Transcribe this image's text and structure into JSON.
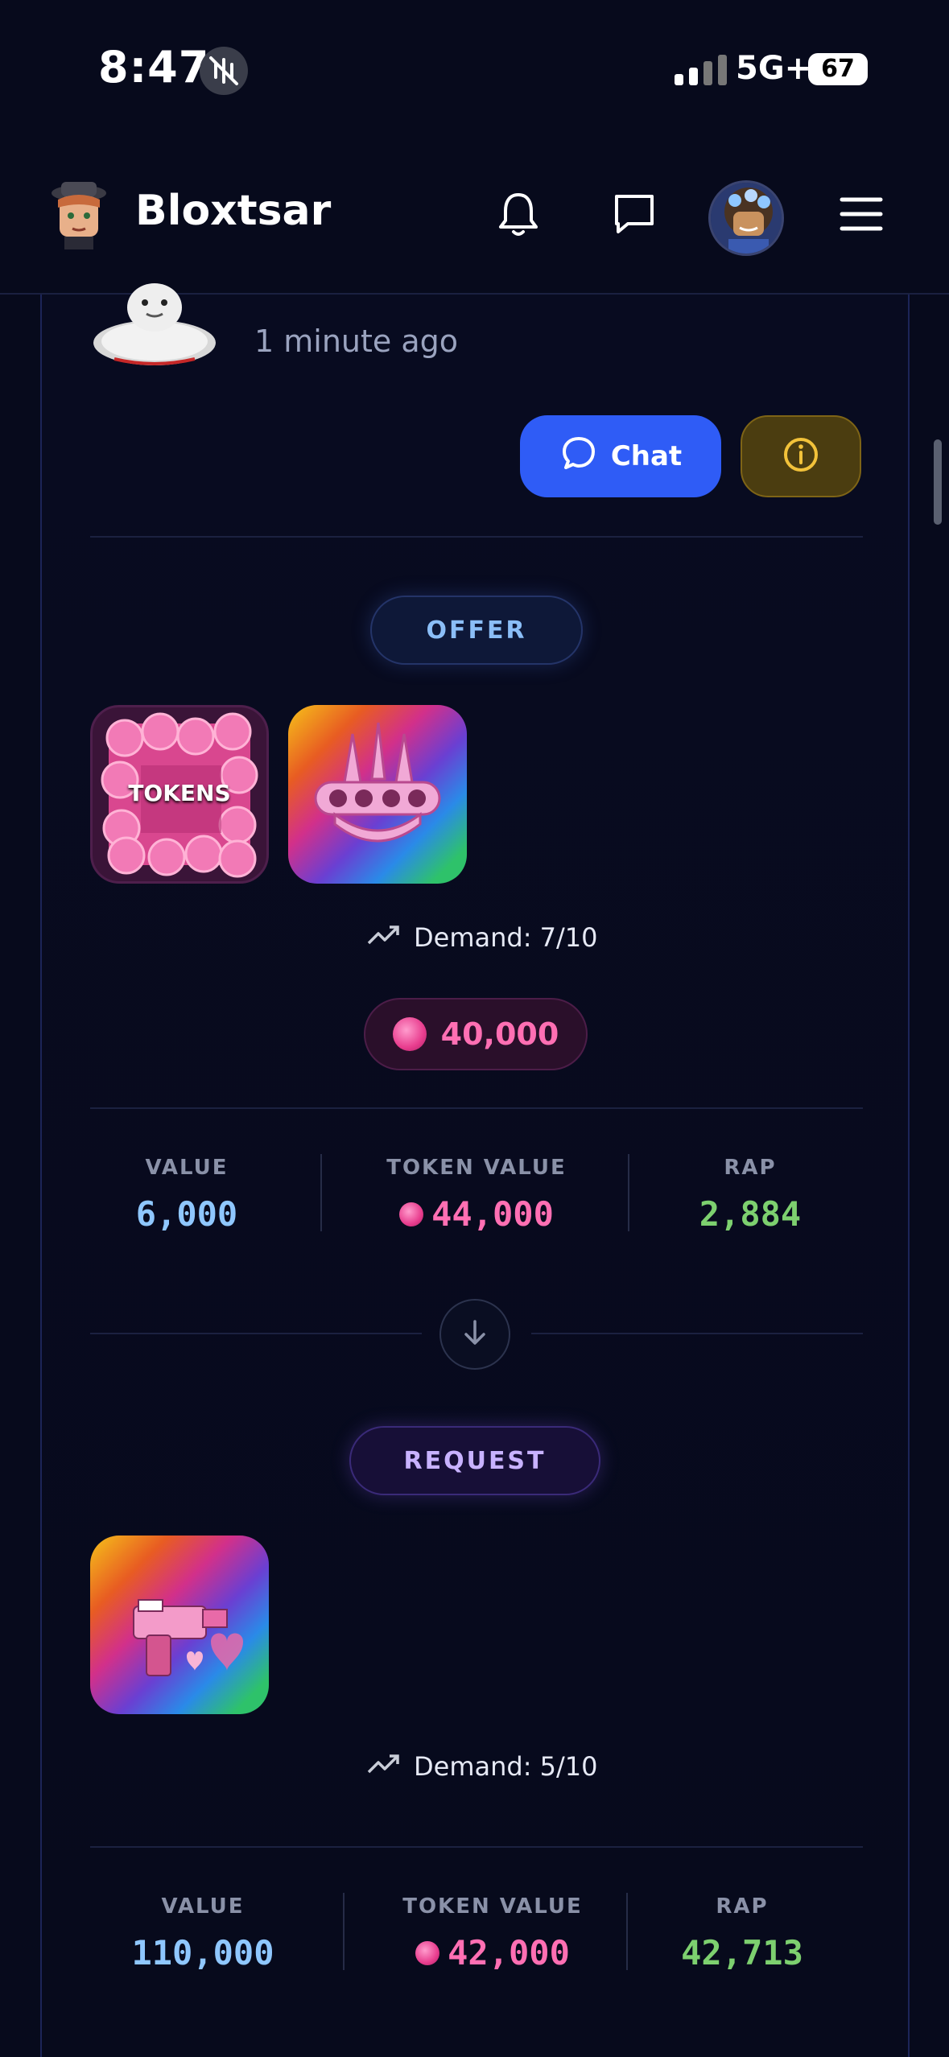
{
  "status_bar": {
    "time": "8:47",
    "network": "5G+",
    "battery": "67"
  },
  "header": {
    "brand": "Bloxtsar"
  },
  "trade": {
    "time_ago": "1 minute ago",
    "chat_label": "Chat",
    "offer": {
      "label": "OFFER",
      "items": [
        {
          "name": "TOKENS",
          "kind": "tokens"
        },
        {
          "name": "",
          "kind": "knuckles"
        }
      ],
      "demand": "Demand: 7/10",
      "token_amount": "40,000",
      "stats": {
        "value_label": "VALUE",
        "value": "6,000",
        "token_value_label": "TOKEN VALUE",
        "token_value": "44,000",
        "rap_label": "RAP",
        "rap": "2,884"
      }
    },
    "request": {
      "label": "REQUEST",
      "items": [
        {
          "name": "",
          "kind": "gun"
        }
      ],
      "demand": "Demand: 5/10",
      "stats": {
        "value_label": "VALUE",
        "value": "110,000",
        "token_value_label": "TOKEN VALUE",
        "token_value": "42,000",
        "rap_label": "RAP",
        "rap": "42,713"
      }
    }
  },
  "colors": {
    "background": "#070a1c",
    "chat_button": "#2f5cf6",
    "info_button": "#4b3d10",
    "value_blue": "#8fc7ff",
    "token_pink": "#ff6fb3",
    "rap_green": "#7dd06f"
  },
  "icons": [
    "bell-icon",
    "message-icon",
    "menu-icon",
    "chat-bubble-icon",
    "info-icon",
    "trend-up-icon",
    "arrow-down-icon",
    "token-coin-icon"
  ]
}
